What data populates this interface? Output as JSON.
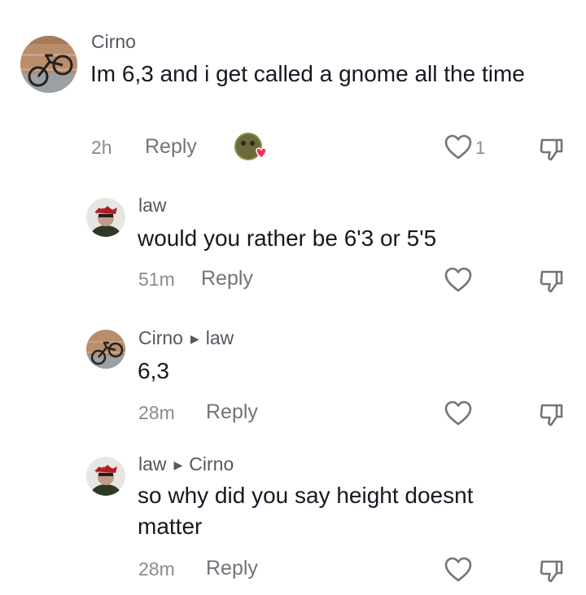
{
  "comments": [
    {
      "author": "Cirno",
      "text": "Im 6,3 and i get called a gnome all the time",
      "time": "2h",
      "reply_label": "Reply",
      "like_count": "1",
      "creator_liked": true
    },
    {
      "author": "law",
      "text": "would you rather be 6'3 or 5'5",
      "time": "51m",
      "reply_label": "Reply"
    },
    {
      "author": "Cirno",
      "reply_to": "law",
      "text": "6,3",
      "time": "28m",
      "reply_label": "Reply"
    },
    {
      "author": "law",
      "reply_to": "Cirno",
      "text": "so why did you say height doesnt matter",
      "time": "28m",
      "reply_label": "Reply"
    }
  ],
  "icons": {
    "like": "heart-outline-icon",
    "dislike": "thumbs-down-icon",
    "reply_arrow": "triangle-right-icon",
    "creator_reaction": "avatar-with-heart-icon"
  },
  "colors": {
    "primary_text": "#161823",
    "secondary_text": "#8a8b91",
    "author_text": "#555761",
    "heart_red": "#fe2c55"
  }
}
